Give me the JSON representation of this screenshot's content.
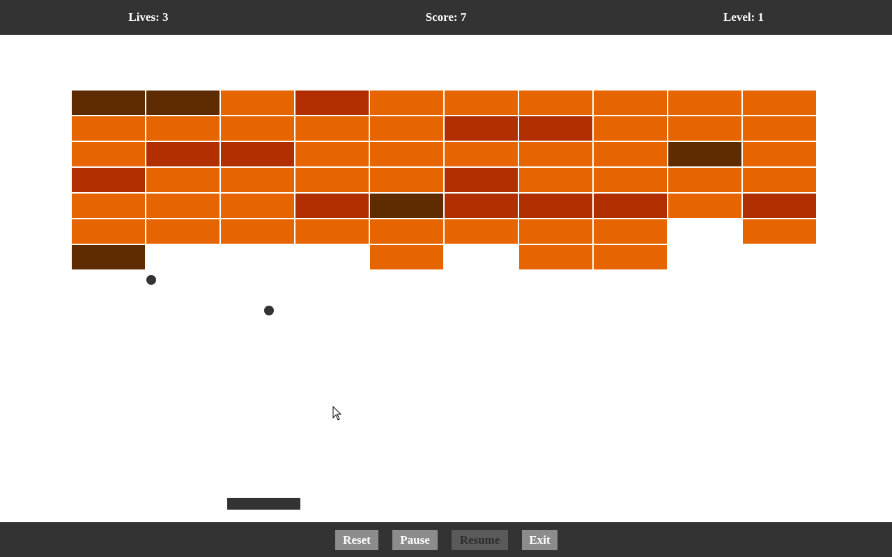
{
  "hud": {
    "lives_label": "Lives: 3",
    "score_label": "Score: 7",
    "level_label": "Level: 1",
    "lives": 3,
    "score": 7,
    "level": 1
  },
  "colors": {
    "bar_background": "#333333",
    "brick_orange": "#e66500",
    "brick_red": "#b02e00",
    "brick_brown": "#5e2c00",
    "ball": "#333333",
    "paddle": "#333333",
    "button": "#8c8c8c",
    "button_disabled": "#5a5a5a"
  },
  "bricks": {
    "columns": 10,
    "rows": [
      [
        "brown",
        "brown",
        "orange",
        "red",
        "orange",
        "orange",
        "orange",
        "orange",
        "orange",
        "orange"
      ],
      [
        "orange",
        "orange",
        "orange",
        "orange",
        "orange",
        "red",
        "red",
        "orange",
        "orange",
        "orange"
      ],
      [
        "orange",
        "red",
        "red",
        "orange",
        "orange",
        "orange",
        "orange",
        "orange",
        "brown",
        "orange"
      ],
      [
        "red",
        "orange",
        "orange",
        "orange",
        "orange",
        "red",
        "orange",
        "orange",
        "orange",
        "orange"
      ],
      [
        "orange",
        "orange",
        "orange",
        "red",
        "brown",
        "red",
        "red",
        "red",
        "orange",
        "red"
      ],
      [
        "orange",
        "orange",
        "orange",
        "orange",
        "orange",
        "orange",
        "orange",
        "orange",
        null,
        "orange"
      ],
      [
        "brown",
        null,
        null,
        null,
        "orange",
        null,
        "orange",
        "orange",
        null,
        null
      ]
    ]
  },
  "balls_count": 2,
  "controls": {
    "reset_label": "Reset",
    "pause_label": "Pause",
    "resume_label": "Resume",
    "exit_label": "Exit",
    "resume_enabled": false
  }
}
